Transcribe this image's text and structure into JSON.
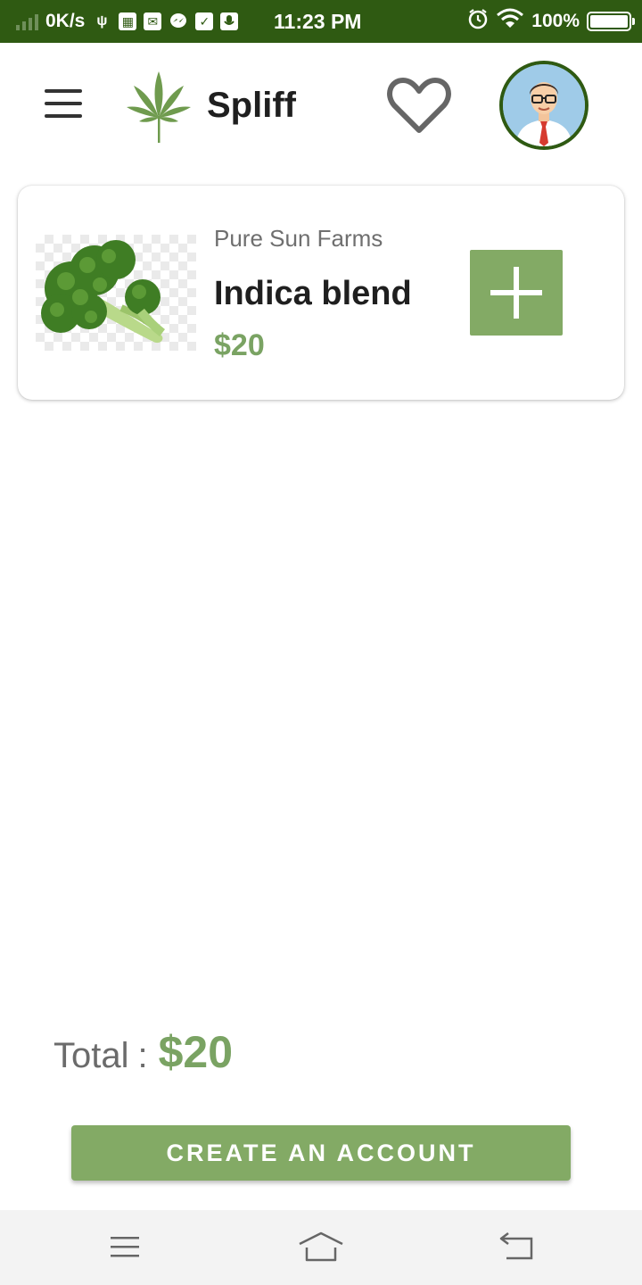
{
  "status_bar": {
    "speed": "0K/s",
    "time": "11:23 PM",
    "battery": "100%",
    "battery_level": 1.0,
    "icons": [
      "signal-icon",
      "usb-icon",
      "sd-card-icon",
      "mail-icon",
      "messenger-icon",
      "clipboard-icon",
      "mic-icon",
      "alarm-icon",
      "wifi-icon",
      "battery-icon"
    ]
  },
  "header": {
    "app_name": "Spliff",
    "icons": [
      "menu-icon",
      "cannabis-leaf-icon",
      "heart-icon",
      "avatar-icon"
    ]
  },
  "cart": {
    "items": [
      {
        "vendor": "Pure Sun Farms",
        "name": "Indica blend",
        "price": "$20",
        "image": "broccoli"
      }
    ]
  },
  "total": {
    "label": "Total",
    "separator": ":",
    "value": "$20"
  },
  "cta": {
    "label": "CREATE AN ACCOUNT"
  },
  "nav_bar": {
    "icons": [
      "recents-icon",
      "home-icon",
      "back-icon"
    ]
  },
  "colors": {
    "brand_dark_green": "#2f5a12",
    "accent_green": "#83aa65",
    "price_green": "#7aa363",
    "text_dark": "#1f1f1f",
    "text_muted": "#6f6f6f"
  }
}
